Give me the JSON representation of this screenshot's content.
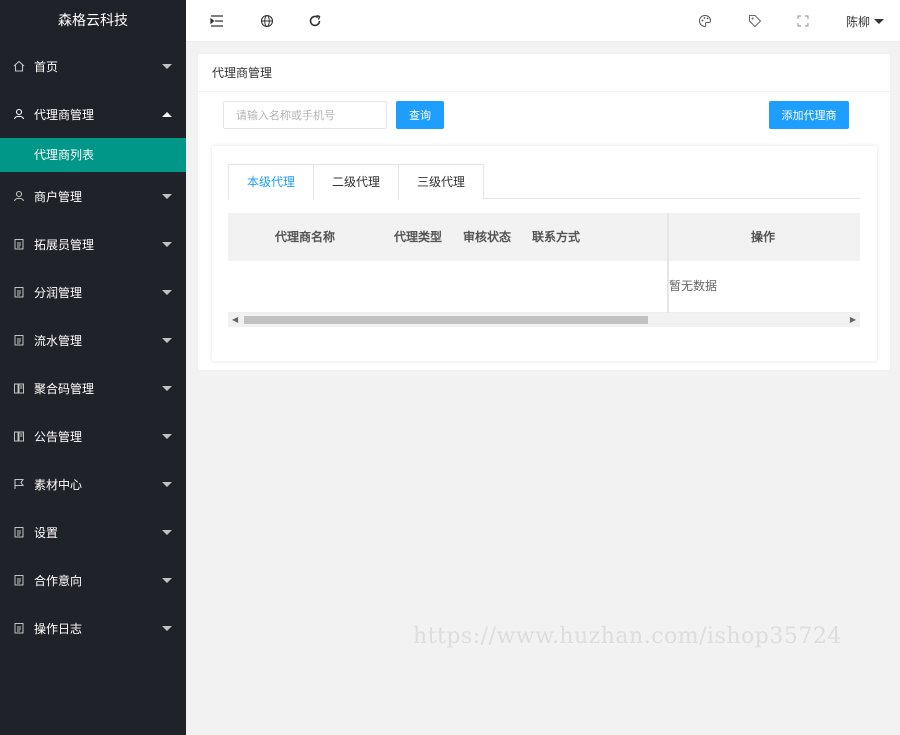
{
  "app": {
    "title": "森格云科技"
  },
  "sidebar": {
    "items": [
      {
        "label": "首页",
        "icon": "home-icon"
      },
      {
        "label": "代理商管理",
        "icon": "user-icon",
        "expanded": true
      },
      {
        "label": "商户管理",
        "icon": "user-icon"
      },
      {
        "label": "拓展员管理",
        "icon": "clipboard-icon"
      },
      {
        "label": "分润管理",
        "icon": "clipboard-icon"
      },
      {
        "label": "流水管理",
        "icon": "clipboard-icon"
      },
      {
        "label": "聚合码管理",
        "icon": "book-icon"
      },
      {
        "label": "公告管理",
        "icon": "book-icon"
      },
      {
        "label": "素材中心",
        "icon": "flag-icon"
      },
      {
        "label": "设置",
        "icon": "clipboard-icon"
      },
      {
        "label": "合作意向",
        "icon": "clipboard-icon"
      },
      {
        "label": "操作日志",
        "icon": "clipboard-icon"
      }
    ],
    "active_sub": "代理商列表"
  },
  "header": {
    "user": "陈柳"
  },
  "main": {
    "card_title": "代理商管理",
    "search_placeholder": "请输入名称或手机号",
    "query_label": "查询",
    "add_label": "添加代理商",
    "tabs": [
      "本级代理",
      "二级代理",
      "三级代理"
    ],
    "columns": [
      "代理商名称",
      "代理类型",
      "审核状态",
      "联系方式",
      "操作"
    ],
    "empty_text": "暂无数据"
  },
  "watermark": "https://www.huzhan.com/ishop35724",
  "colors": {
    "sidebar": "#20222a",
    "active": "#009688",
    "primary": "#1e9fff"
  }
}
